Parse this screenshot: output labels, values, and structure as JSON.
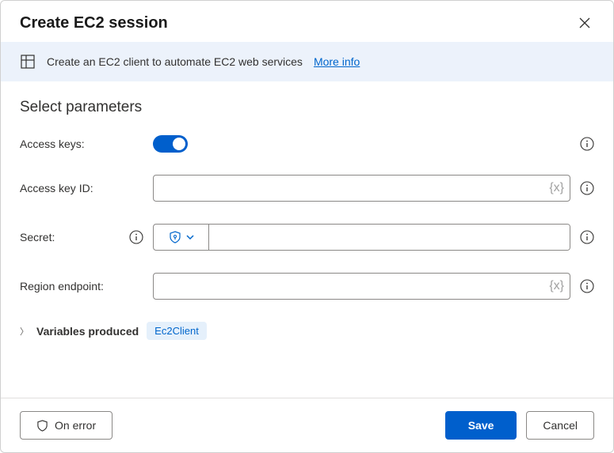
{
  "header": {
    "title": "Create EC2 session"
  },
  "banner": {
    "text": "Create an EC2 client to automate EC2 web services",
    "link_label": "More info"
  },
  "section": {
    "title": "Select parameters"
  },
  "fields": {
    "access_keys": {
      "label": "Access keys:",
      "enabled": true
    },
    "access_key_id": {
      "label": "Access key ID:",
      "value": "",
      "suffix": "{x}"
    },
    "secret": {
      "label": "Secret:",
      "value": ""
    },
    "region_endpoint": {
      "label": "Region endpoint:",
      "value": "",
      "suffix": "{x}"
    }
  },
  "variables": {
    "label": "Variables produced",
    "chip": "Ec2Client"
  },
  "footer": {
    "on_error": "On error",
    "save": "Save",
    "cancel": "Cancel"
  }
}
